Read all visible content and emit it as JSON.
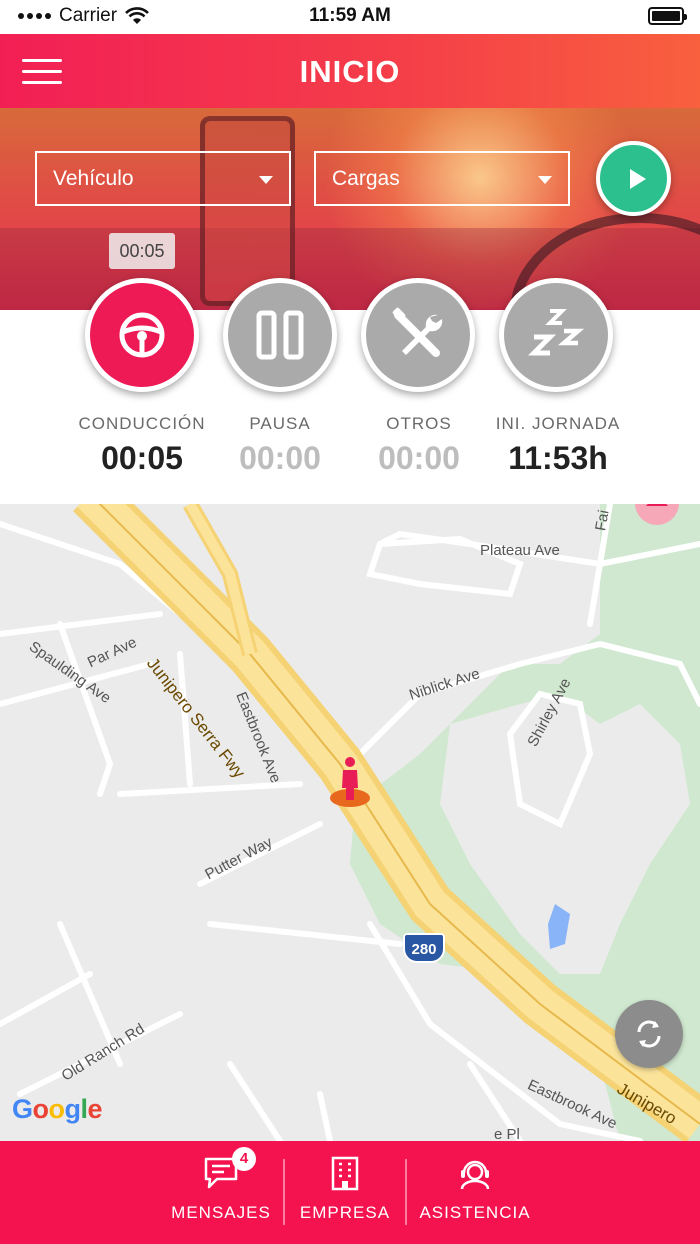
{
  "status_bar": {
    "carrier": "Carrier",
    "time": "11:59 AM"
  },
  "header": {
    "title": "INICIO"
  },
  "selectors": {
    "vehicle": "Vehículo",
    "cargas": "Cargas"
  },
  "timer_chip": "00:05",
  "activities": [
    {
      "label": "CONDUCCIÓN",
      "value": "00:05",
      "icon": "steering-wheel-icon"
    },
    {
      "label": "PAUSA",
      "value": "00:00",
      "icon": "pause-icon"
    },
    {
      "label": "OTROS",
      "value": "00:00",
      "icon": "tools-icon"
    },
    {
      "label": "INI. JORNADA",
      "value": "11:53h",
      "icon": "sleep-icon"
    }
  ],
  "map": {
    "streets": [
      "Plateau Ave",
      "Par Ave",
      "Spaulding Ave",
      "Eastbrook Ave",
      "Niblick Ave",
      "Shirley Ave",
      "Putter Way",
      "Old Ranch Rd",
      "Eastbrook Ave",
      "Fai",
      "e Pl"
    ],
    "freeway_labels": [
      "Junipero Serra Fwy",
      "Junipero"
    ],
    "shield": "280",
    "attribution": "Google"
  },
  "nav": {
    "messages": {
      "label": "MENSAJES",
      "badge": "4"
    },
    "company": {
      "label": "EMPRESA"
    },
    "assistance": {
      "label": "ASISTENCIA"
    }
  },
  "colors": {
    "brand": "#f4134f",
    "play": "#2cc08e",
    "inactive": "#aaaaaa"
  }
}
